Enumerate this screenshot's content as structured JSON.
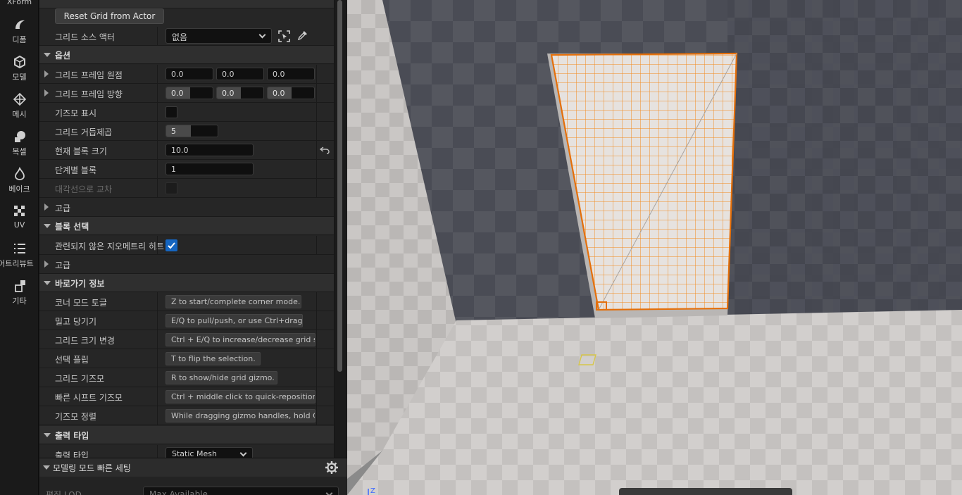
{
  "toolstrip": {
    "top_label": "XForm",
    "items": [
      {
        "label": "디폼",
        "icon": "deform-icon"
      },
      {
        "label": "모델",
        "icon": "model-icon"
      },
      {
        "label": "메시",
        "icon": "mesh-icon"
      },
      {
        "label": "복셀",
        "icon": "voxel-icon"
      },
      {
        "label": "베이크",
        "icon": "bake-icon"
      },
      {
        "label": "UV",
        "icon": "uv-icon"
      },
      {
        "label": "어트리뷰트",
        "icon": "attribute-icon"
      },
      {
        "label": "기타",
        "icon": "misc-icon"
      }
    ]
  },
  "panel": {
    "reset_button": "Reset Grid from Actor",
    "grid_source_actor": {
      "label": "그리드 소스 액터",
      "value": "없음"
    },
    "options_section": "옵션",
    "grid_frame_origin": {
      "label": "그리드 프레임 원점",
      "values": [
        "0.0",
        "0.0",
        "0.0"
      ]
    },
    "grid_frame_orientation": {
      "label": "그리드 프레임 방향",
      "values": [
        "0.0",
        "0.0",
        "0.0"
      ]
    },
    "show_gizmo": {
      "label": "기즈모 표시",
      "checked": false
    },
    "grid_power": {
      "label": "그리드 거듭제곱",
      "value": "5"
    },
    "current_block_size": {
      "label": "현재 블록 크기",
      "value": "10.0"
    },
    "blocks_per_step": {
      "label": "단계별 블록",
      "value": "1"
    },
    "diagonal_cross": {
      "label": "대각선으로 교차",
      "checked": false
    },
    "advanced_1": "고급",
    "block_selection_section": "블록 선택",
    "hit_unrelated_geometry": {
      "label": "관련되지 않은 지오메트리 히트",
      "checked": true
    },
    "advanced_2": "고급",
    "shortcut_section": "바로가기 정보",
    "shortcuts": [
      {
        "label": "코너 모드 토글",
        "hint": "Z to start/complete corner mode."
      },
      {
        "label": "밀고 당기기",
        "hint": "E/Q to pull/push, or use Ctrl+drag."
      },
      {
        "label": "그리드 크기 변경",
        "hint": "Ctrl + E/Q to increase/decrease grid s"
      },
      {
        "label": "선택 플립",
        "hint": "T to flip the selection."
      },
      {
        "label": "그리드 기즈모",
        "hint": "R to show/hide grid gizmo."
      },
      {
        "label": "빠른 시프트 기즈모",
        "hint": "Ctrl + middle click to quick-reposition"
      },
      {
        "label": "기즈모 정렬",
        "hint": "While dragging gizmo handles, hold Ct"
      }
    ],
    "output_section": "출력 타입",
    "output_type": {
      "label": "출력 타입",
      "value": "Static Mesh"
    }
  },
  "quick_settings": {
    "title": "모델링 모드 빠른 세팅",
    "edit_lod_label": "편집 LOD",
    "edit_lod_value": "Max Available"
  },
  "viewport": {
    "axis_label": "Z",
    "colors": {
      "selection": "#ff8c1a",
      "wall_dark": "#4a4c55",
      "floor_light": "#c9c6c4"
    }
  }
}
